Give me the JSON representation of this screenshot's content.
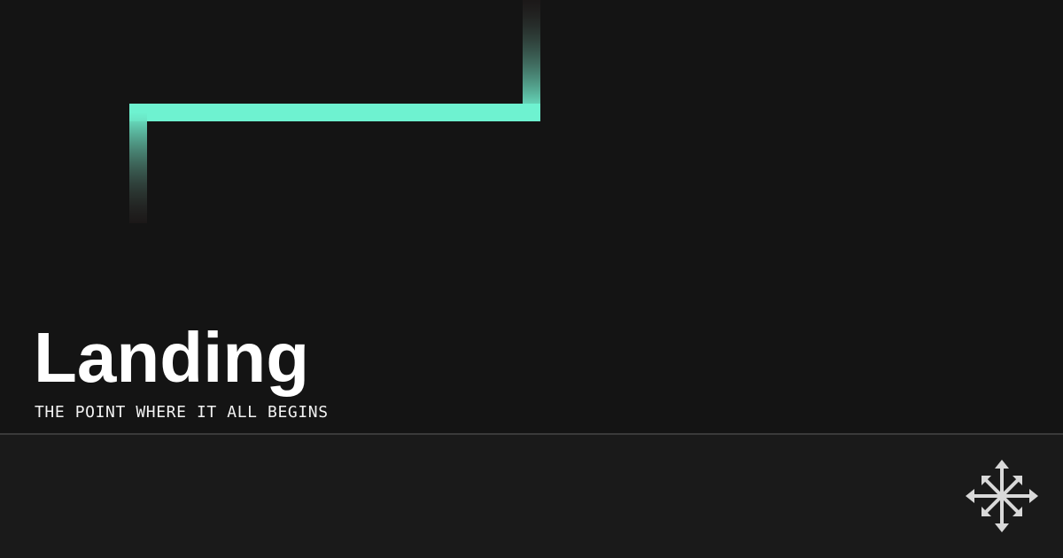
{
  "hero": {
    "title": "Landing",
    "subtitle": "THE POINT WHERE IT ALL BEGINS"
  },
  "icons": {
    "path_graphic": "step-path-graphic",
    "logo": "compass-arrows-icon"
  },
  "colors": {
    "background": "#141414",
    "footer": "#1a1a1a",
    "accent": "#6ef2d0",
    "fade": "#3a2a2a",
    "divider": "#3a3a3a",
    "logo": "#d9d9d9"
  }
}
